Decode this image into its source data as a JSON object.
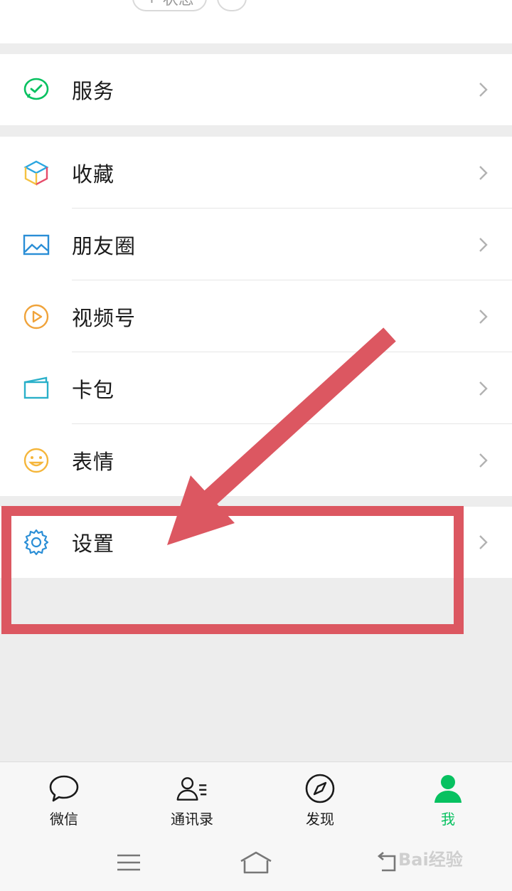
{
  "profile": {
    "status_label": "状态",
    "status_prefix": "+"
  },
  "menu": {
    "service": {
      "label": "服务"
    },
    "items": [
      {
        "label": "收藏",
        "icon": "favorites-cube-icon"
      },
      {
        "label": "朋友圈",
        "icon": "moments-image-icon"
      },
      {
        "label": "视频号",
        "icon": "channels-play-icon"
      },
      {
        "label": "卡包",
        "icon": "card-wallet-icon"
      },
      {
        "label": "表情",
        "icon": "stickers-smiley-icon"
      }
    ],
    "settings": {
      "label": "设置",
      "icon": "gear-icon"
    }
  },
  "tabbar": {
    "tabs": [
      {
        "label": "微信",
        "icon": "chat-bubble-icon",
        "active": false
      },
      {
        "label": "通讯录",
        "icon": "contacts-icon",
        "active": false
      },
      {
        "label": "发现",
        "icon": "compass-icon",
        "active": false
      },
      {
        "label": "我",
        "icon": "person-icon",
        "active": true
      }
    ]
  },
  "colors": {
    "accent": "#07c160",
    "annotation": "#dc5761",
    "chevron": "#b2b2b2"
  },
  "watermark": {
    "text": "Bai经验"
  }
}
